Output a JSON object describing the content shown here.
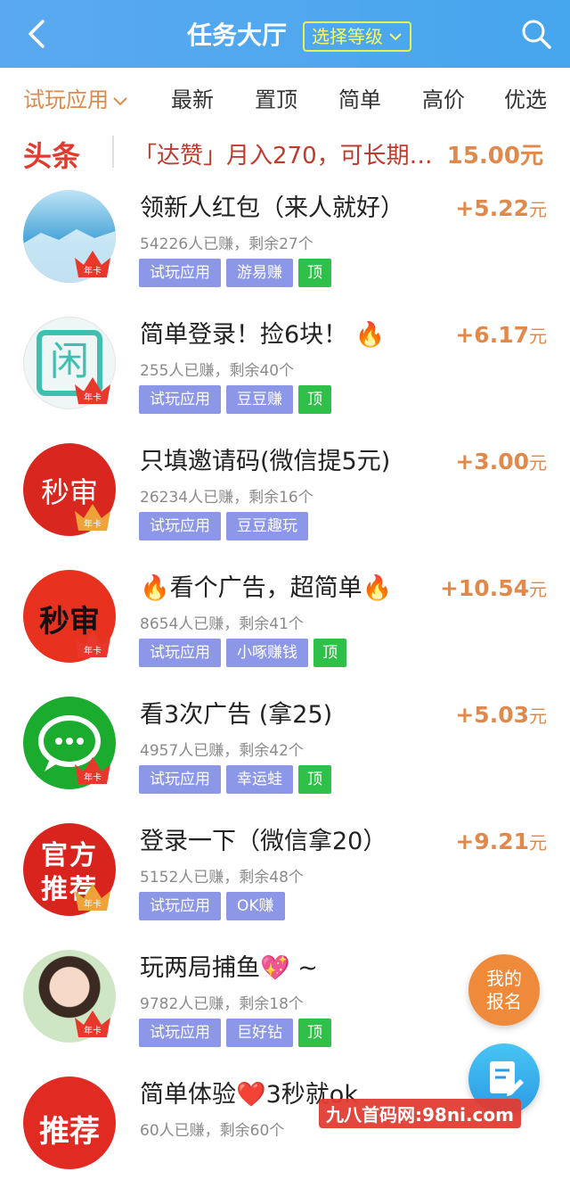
{
  "header": {
    "title": "任务大厅",
    "level_label": "选择等级"
  },
  "tabs": [
    {
      "label": "试玩应用",
      "active": true
    },
    {
      "label": "最新"
    },
    {
      "label": "置顶"
    },
    {
      "label": "简单"
    },
    {
      "label": "高价"
    },
    {
      "label": "优选"
    }
  ],
  "headline": {
    "tag": "头条",
    "text": "「达赞」月入270，可长期…",
    "price": "15.00元"
  },
  "items": [
    {
      "title": "领新人红包（来人就好）",
      "meta": "54226人已赚，剩余27个",
      "tags": [
        "试玩应用",
        "游易赚"
      ],
      "top": true,
      "price": "+5.22",
      "unit": "元",
      "avatar_text": ""
    },
    {
      "title": "简单登录！捡6块！ 🔥",
      "meta": "255人已赚，剩余40个",
      "tags": [
        "试玩应用",
        "豆豆赚"
      ],
      "top": true,
      "price": "+6.17",
      "unit": "元",
      "avatar_text": "闲"
    },
    {
      "title": "只填邀请码(微信提5元)",
      "meta": "26234人已赚，剩余16个",
      "tags": [
        "试玩应用",
        "豆豆趣玩"
      ],
      "top": false,
      "price": "+3.00",
      "unit": "元",
      "avatar_text": "秒审"
    },
    {
      "title": "🔥看个广告，超简单🔥",
      "meta": "8654人已赚，剩余41个",
      "tags": [
        "试玩应用",
        "小啄赚钱"
      ],
      "top": true,
      "price": "+10.54",
      "unit": "元",
      "avatar_text": "秒审"
    },
    {
      "title": "看3次广告 (拿25)",
      "meta": "4957人已赚，剩余42个",
      "tags": [
        "试玩应用",
        "幸运蛙"
      ],
      "top": true,
      "price": "+5.03",
      "unit": "元",
      "avatar_text": ""
    },
    {
      "title": "登录一下（微信拿20）",
      "meta": "5152人已赚，剩余48个",
      "tags": [
        "试玩应用",
        "OK赚"
      ],
      "top": false,
      "price": "+9.21",
      "unit": "元",
      "avatar_text": "官方推荐"
    },
    {
      "title": "玩两局捕鱼💖 ~",
      "meta": "9782人已赚，剩余18个",
      "tags": [
        "试玩应用",
        "巨好钻"
      ],
      "top": true,
      "price": "",
      "unit": "",
      "avatar_text": ""
    },
    {
      "title": "简单体验❤️3秒就ok",
      "meta": "60人已赚，剩余60个",
      "tags": [],
      "top": false,
      "price": "",
      "unit": "",
      "avatar_text": "推荐"
    }
  ],
  "top_label": "顶",
  "badge_label": "年卡",
  "float": {
    "signup": "我的报名"
  },
  "watermark": "九八首码网:98ni.com",
  "colors": {
    "header": "#46a6ee",
    "accent": "#e0894b",
    "tag": "#8d97e8",
    "top_tag": "#2fc04a",
    "headline_red": "#e23a2e"
  }
}
